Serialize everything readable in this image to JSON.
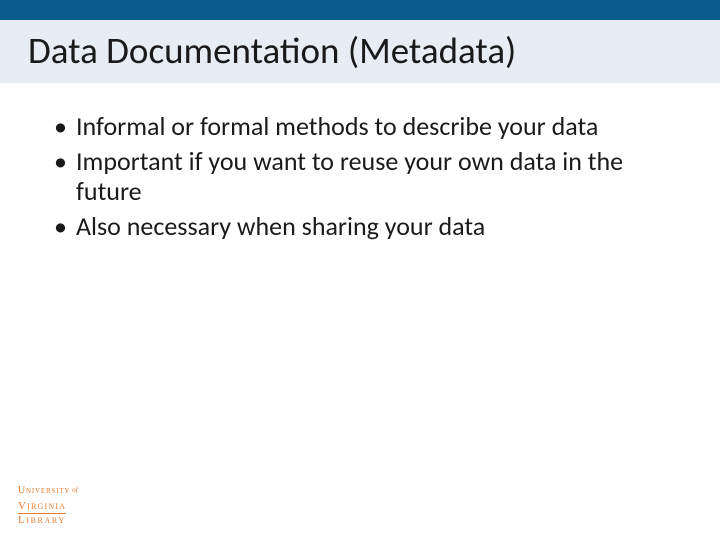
{
  "slide": {
    "title": "Data Documentation (Metadata)",
    "bullets": [
      "Informal or formal methods to describe your data",
      "Important if you want to reuse your own data in the future",
      "Also necessary when sharing your data"
    ]
  },
  "footer": {
    "line1a": "University",
    "line1b": "of",
    "line2": "Virginia",
    "line3": "Library"
  },
  "colors": {
    "topbar": "#0a5a8a",
    "titleband": "#e8edf3",
    "logo": "#e67a2e"
  }
}
